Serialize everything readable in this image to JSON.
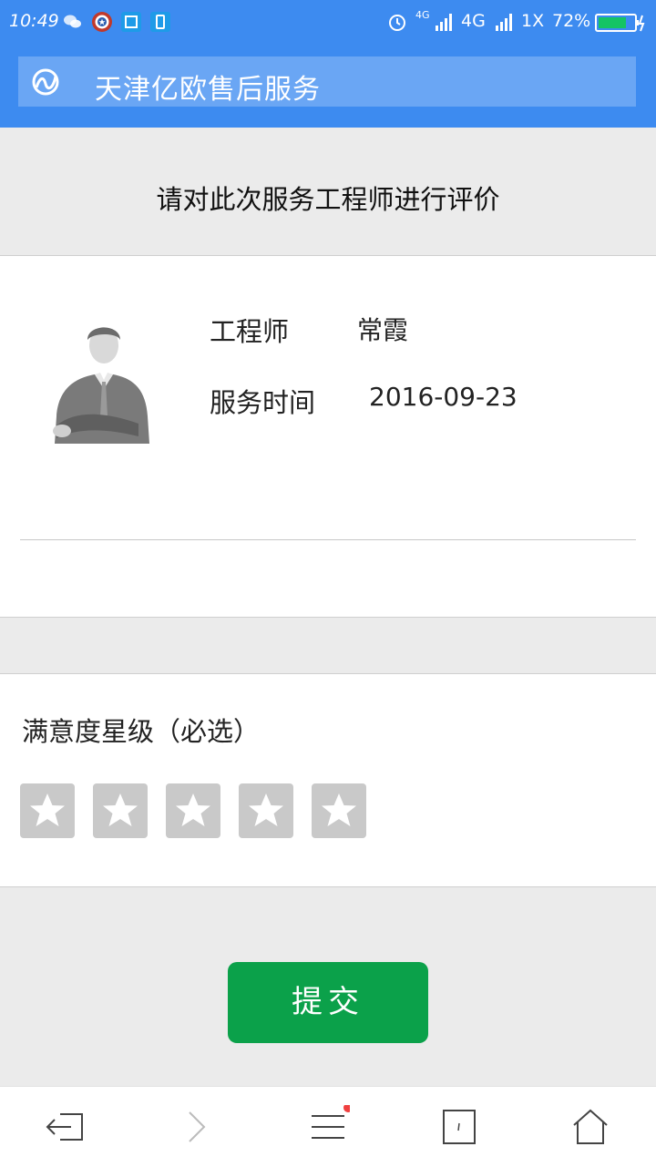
{
  "status_bar": {
    "time": "10:49",
    "network_4g": "4G",
    "network_1x": "1X",
    "battery": "72%",
    "small_4g": "4G"
  },
  "header": {
    "title": "天津亿欧售后服务",
    "logo_icon": "app-logo-icon"
  },
  "evaluation": {
    "prompt": "请对此次服务工程师进行评价"
  },
  "engineer": {
    "label_engineer": "工程师",
    "name": "常霞",
    "label_time": "服务时间",
    "service_date": "2016-09-23"
  },
  "rating": {
    "label": "满意度星级（必选）",
    "max_stars": 5,
    "selected": 0,
    "star_color": "#c9c9c9"
  },
  "submit": {
    "label": "提交",
    "color": "#0ba14a"
  },
  "bottom_nav": [
    "back-icon",
    "forward-icon",
    "menu-icon",
    "tabs-icon",
    "home-icon"
  ],
  "colors": {
    "header_bg": "#3d8bf0"
  }
}
